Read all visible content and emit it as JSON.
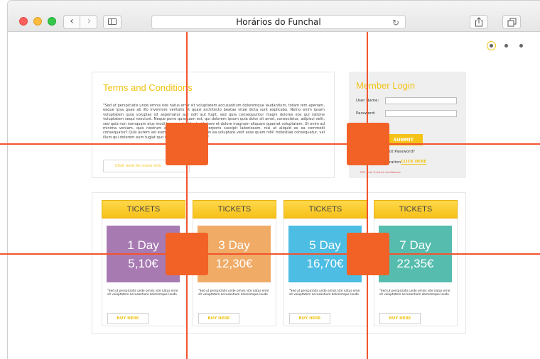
{
  "browser": {
    "title": "Horários do Funchal",
    "back_glyph": "‹",
    "forward_glyph": "›",
    "reload_glyph": "↻"
  },
  "pager": {
    "count": 3,
    "active": 0
  },
  "terms": {
    "title": "Terms and Conditions",
    "body": "\"Sed ut perspiciatis unde omnis iste natus error sit voluptatem accusantium doloremque laudantium, totam rem aperiam, eaque ipsa quae ab illo inventore veritatis et quasi architecto beatae vitae dicta sunt explicabo. Nemo enim ipsam voluptatem quia voluptas sit aspernatur aut odit aut fugit, sed quia consequuntur magni dolores eos qui ratione voluptatem sequi nesciunt. Neque porro quisquam est, qui dolorem ipsum quia dolor sit amet, consectetur, adipisci velit, sed quia non numquam eius modi tempora incidunt ut labore et dolore magnam aliquam quaerat voluptatem. Ut enim ad minima veniam, quis nostrum exercitationem ullam corporis suscipit laboriosam, nisi ut aliquid ex ea commodi consequatur? Quis autem vel eum iure reprehenderit qui in ea voluptate velit esse quam nihil molestiae consequatur, vel illum qui dolorem eum fugiat quo voluptas nulla pariatur?\"",
    "more_label": "Click here for more info"
  },
  "login": {
    "title": "Member Login",
    "username_label": "User Name:",
    "password_label": "Password:",
    "submit_label": "SUBMIT",
    "forgot_label": "Forgot Password?",
    "register_label": "Registration",
    "click_here_label": "CLICK HERE",
    "pdf_label": "PDF Guia Turístico da Madeira"
  },
  "tickets": [
    {
      "header": "TICKETS",
      "days": "1 Day",
      "price": "5,10€",
      "color": "#a87ab2",
      "desc": "\"Sed ut perspiciatis unde omnis iste natus error sit voluptatem accusantium doloremque laudo",
      "buy_label": "BUY HERE"
    },
    {
      "header": "TICKETS",
      "days": "3 Day",
      "price": "12,30€",
      "color": "#f0ab67",
      "desc": "\"Sed ut perspiciatis unde omnis iste natus error sit voluptatem accusantium doloremque laudo",
      "buy_label": "BUY HERE"
    },
    {
      "header": "TICKETS",
      "days": "5 Day",
      "price": "16,70€",
      "color": "#4dbde4",
      "desc": "\"Sed ut perspiciatis unde omnis iste natus error sit voluptatem accusantium doloremque laudo",
      "buy_label": "BUY HERE"
    },
    {
      "header": "TICKETS",
      "days": "7 Day",
      "price": "22,35€",
      "color": "#56bdae",
      "desc": "\"Sed ut perspiciatis unde omnis iste natus error sit voluptatem accusantium doloremque laudo",
      "buy_label": "BUY HERE"
    }
  ],
  "colors": {
    "accent": "#f2c316",
    "overlay": "#f2542d",
    "handle": "#f26227"
  }
}
